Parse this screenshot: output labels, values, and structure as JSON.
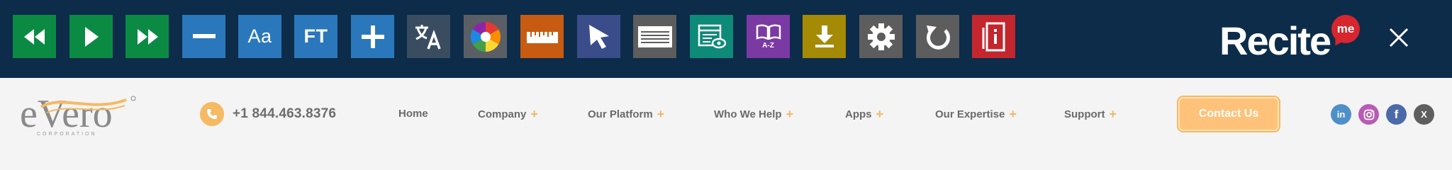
{
  "recite_toolbar": {
    "tools": [
      {
        "name": "rewind",
        "icon": "rewind-icon",
        "color": "#0b8a43"
      },
      {
        "name": "play",
        "icon": "play-icon",
        "color": "#0b8a43"
      },
      {
        "name": "fast-forward",
        "icon": "fast-forward-icon",
        "color": "#0b8a43"
      },
      {
        "name": "decrease-text",
        "icon": "minus-icon",
        "color": "#2a78bb"
      },
      {
        "name": "font",
        "icon": "font-icon",
        "label": "Aa",
        "color": "#2a78bb"
      },
      {
        "name": "font-type",
        "icon": "font-type-icon",
        "label": "FT",
        "color": "#2a78bb"
      },
      {
        "name": "increase-text",
        "icon": "plus-icon",
        "color": "#2a78bb"
      },
      {
        "name": "translate",
        "icon": "translate-icon",
        "color": "#3a4c60"
      },
      {
        "name": "color-settings",
        "icon": "color-wheel-icon",
        "color": "#5a5f66"
      },
      {
        "name": "ruler",
        "icon": "ruler-icon",
        "color": "#c75b12"
      },
      {
        "name": "pointer",
        "icon": "cursor-icon",
        "color": "#3a4c8a"
      },
      {
        "name": "screen-mask",
        "icon": "screen-mask-icon",
        "color": "#5d5d5d"
      },
      {
        "name": "text-only-mode",
        "icon": "text-only-icon",
        "color": "#0e8a78"
      },
      {
        "name": "dictionary",
        "icon": "dictionary-icon",
        "label": "A-Z",
        "color": "#7b3aa3"
      },
      {
        "name": "download",
        "icon": "download-icon",
        "color": "#a58a06"
      },
      {
        "name": "settings",
        "icon": "gear-icon",
        "color": "#5d5d5d"
      },
      {
        "name": "reset",
        "icon": "reset-icon",
        "color": "#5d5d5d"
      },
      {
        "name": "pdf-reader",
        "icon": "document-info-icon",
        "color": "#c4262e"
      }
    ],
    "logo_text": "Recite",
    "logo_badge": "me"
  },
  "header": {
    "logo_text": "eVero",
    "logo_tagline": "CORPORATION",
    "phone": "+1 844.463.8376",
    "nav": [
      {
        "label": "Home",
        "has_submenu": false
      },
      {
        "label": "Company",
        "has_submenu": true
      },
      {
        "label": "Our Platform",
        "has_submenu": true
      },
      {
        "label": "Who We Help",
        "has_submenu": true
      },
      {
        "label": "Apps",
        "has_submenu": true
      },
      {
        "label": "Our Expertise",
        "has_submenu": true
      },
      {
        "label": "Support",
        "has_submenu": true
      }
    ],
    "submenu_marker": "+",
    "cta": "Contact Us",
    "social": [
      {
        "name": "linkedin",
        "icon": "linkedin-icon",
        "label": "in",
        "color": "#4f8fc8"
      },
      {
        "name": "instagram",
        "icon": "instagram-icon",
        "color": "#b85bb4"
      },
      {
        "name": "facebook",
        "icon": "facebook-icon",
        "label": "f",
        "color": "#4a6aa8"
      },
      {
        "name": "x",
        "icon": "x-icon",
        "label": "X",
        "color": "#5f5f5f"
      }
    ]
  },
  "colors": {
    "toolbar_bg": "#0c2c4a",
    "accent": "#f6b964",
    "recite_red": "#d7262e"
  }
}
